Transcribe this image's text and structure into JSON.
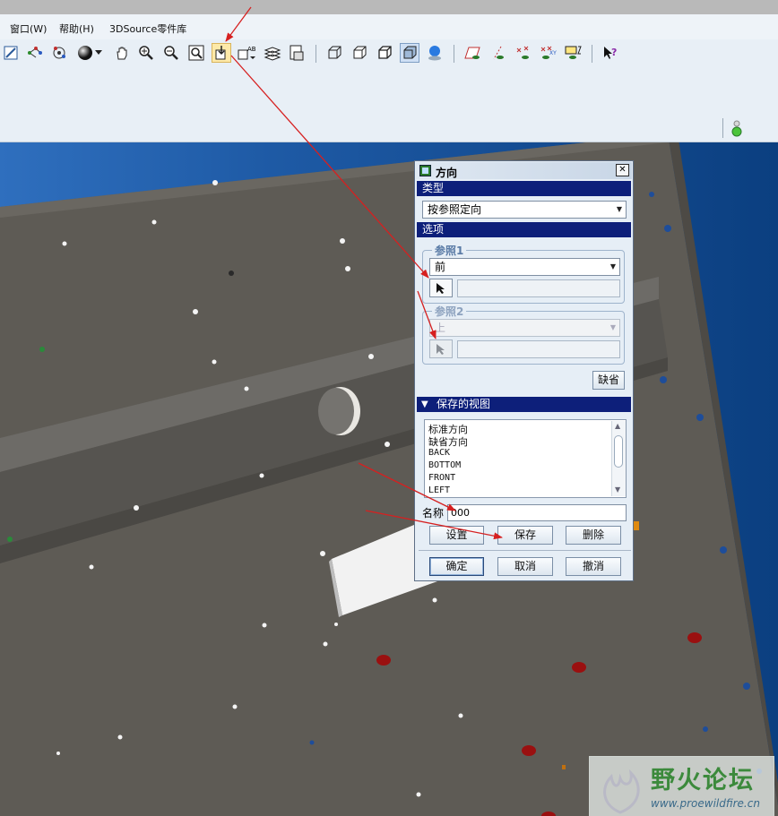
{
  "menubar": {
    "items": [
      "窗口(W)",
      "帮助(H)",
      "3DSource零件库"
    ]
  },
  "toolbar": {
    "icons": [
      "repaint-icon",
      "datum-display-icon",
      "spin-center-icon",
      "shading-icon",
      "pan-icon",
      "zoom-in-icon",
      "zoom-out-icon",
      "refit-icon",
      "reorient-icon",
      "saved-views-icon",
      "layers-icon",
      "view-manager-icon",
      "wireframe-icon",
      "hidden-line-icon",
      "no-hidden-icon",
      "shaded-icon",
      "enhanced-realism-icon",
      "datum-planes-icon",
      "datum-axes-icon",
      "datum-points-icon",
      "coord-sys-icon",
      "annotations-icon",
      "whats-this-icon"
    ]
  },
  "dialog": {
    "title": "方向",
    "close_label": "✕",
    "type_section": "类型",
    "type_value": "按参照定向",
    "options_section": "选项",
    "ref1_label": "参照1",
    "ref1_value": "前",
    "ref2_label": "参照2",
    "ref2_value": "上",
    "default_button": "缺省",
    "saved_views_section": "保存的视图",
    "saved_views": [
      "标准方向",
      "缺省方向",
      "BACK",
      "BOTTOM",
      "FRONT",
      "LEFT"
    ],
    "name_label": "名称",
    "name_value": "000",
    "set_button": "设置",
    "save_button": "保存",
    "delete_button": "删除",
    "ok_button": "确定",
    "cancel_button": "取消",
    "undo_button": "撤消"
  },
  "watermark": {
    "brand": "野火论坛",
    "url": "www.proewildfire.cn"
  },
  "colors": {
    "section_bar": "#0d1f7a",
    "model_grey": "#5e5b55",
    "annotation_arrow": "#d62020"
  }
}
